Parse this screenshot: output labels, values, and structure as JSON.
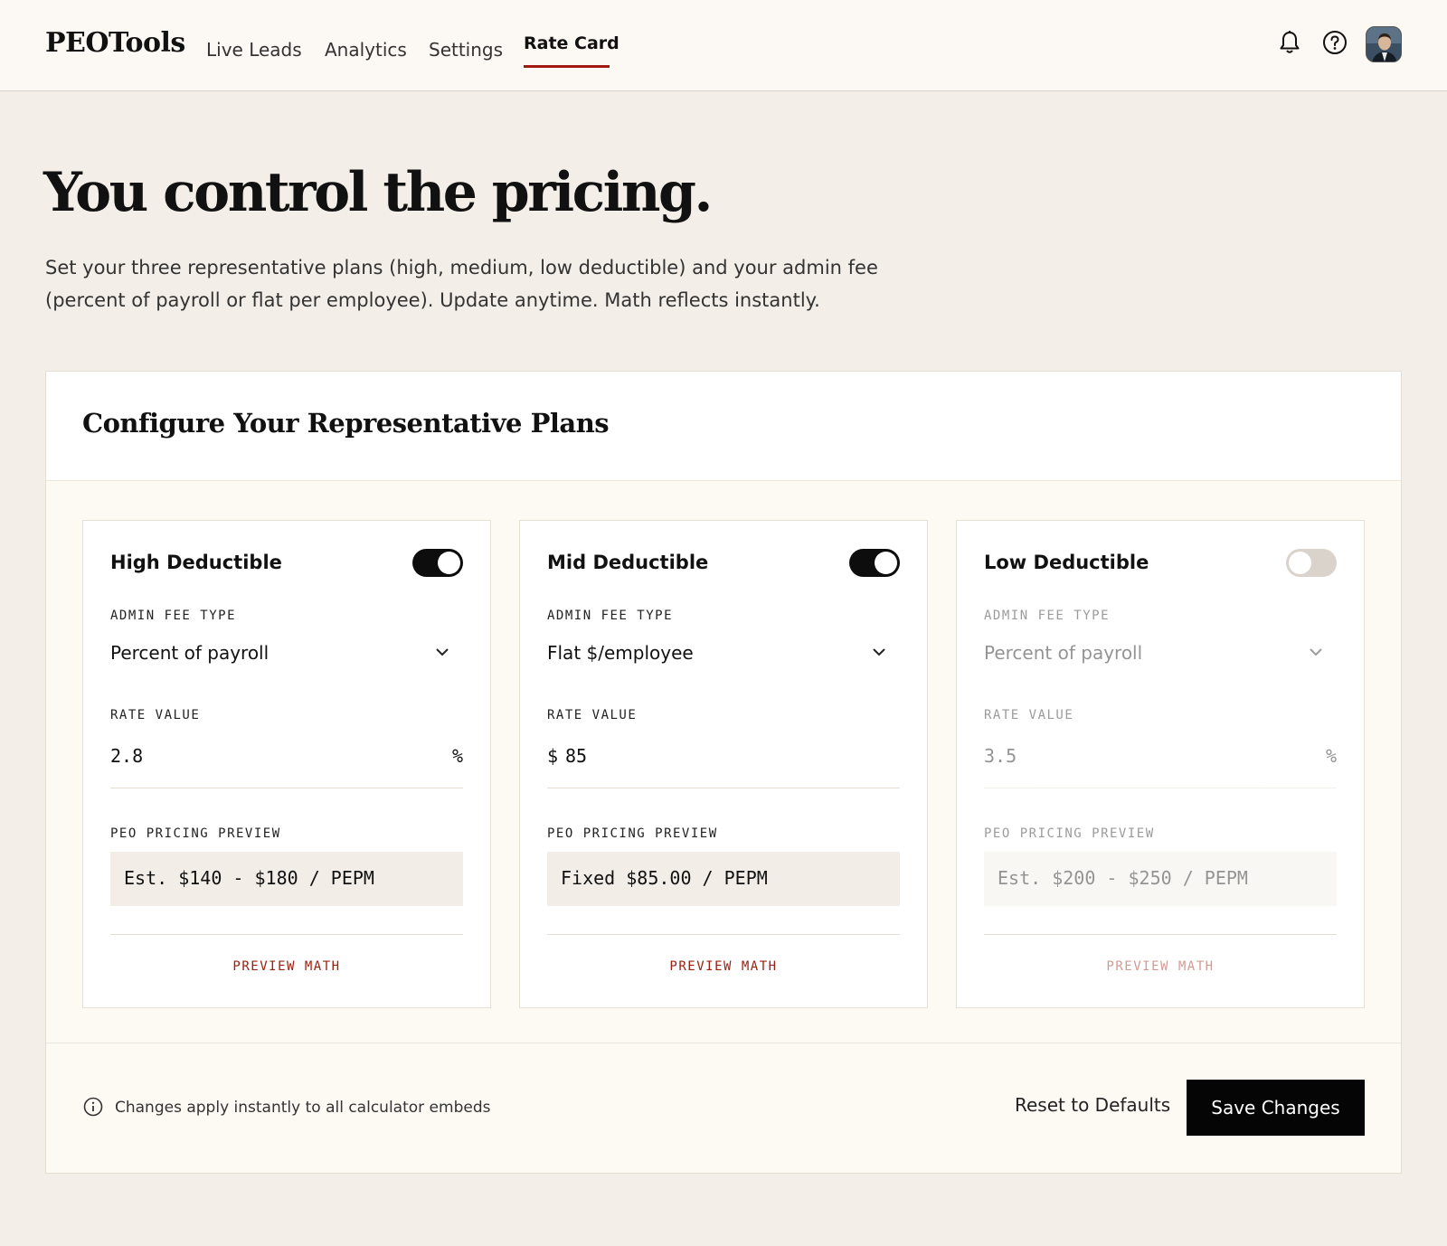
{
  "header": {
    "logo": "PEOTools",
    "nav": [
      {
        "label": "Live Leads"
      },
      {
        "label": "Analytics"
      },
      {
        "label": "Settings"
      },
      {
        "label": "Rate Card",
        "active": true
      }
    ],
    "icons": [
      "bell-icon",
      "help-icon"
    ],
    "avatar": "user-avatar"
  },
  "hero": {
    "title": "You control the pricing.",
    "subtitle": "Set your three representative plans (high, medium, low deductible) and your admin fee (percent of payroll or flat per employee). Update anytime. Math reflects instantly."
  },
  "panel": {
    "title": "Configure Your Representative Plans",
    "field_labels": {
      "admin_fee_type": "ADMIN FEE TYPE",
      "rate_value": "RATE VALUE",
      "pricing_preview": "PEO PRICING PREVIEW",
      "preview_math": "PREVIEW MATH"
    },
    "plans": [
      {
        "name": "High Deductible",
        "enabled": true,
        "admin_fee_type": "Percent of payroll",
        "rate_prefix": "",
        "rate_value": "2.8",
        "rate_suffix": "%",
        "preview": "Est. $140 - $180 / PEPM"
      },
      {
        "name": "Mid Deductible",
        "enabled": true,
        "admin_fee_type": "Flat $/employee",
        "rate_prefix": "$",
        "rate_value": "85",
        "rate_suffix": "",
        "preview": "Fixed $85.00 / PEPM"
      },
      {
        "name": "Low Deductible",
        "enabled": false,
        "admin_fee_type": "Percent of payroll",
        "rate_prefix": "",
        "rate_value": "3.5",
        "rate_suffix": "%",
        "preview": "Est. $200 - $250 / PEPM"
      }
    ]
  },
  "footer": {
    "info": "Changes apply instantly to all calculator embeds",
    "reset_label": "Reset to Defaults",
    "save_label": "Save Changes"
  },
  "colors": {
    "accent": "#a01a12",
    "background": "#f3efe8",
    "primary_button": "#050505"
  }
}
